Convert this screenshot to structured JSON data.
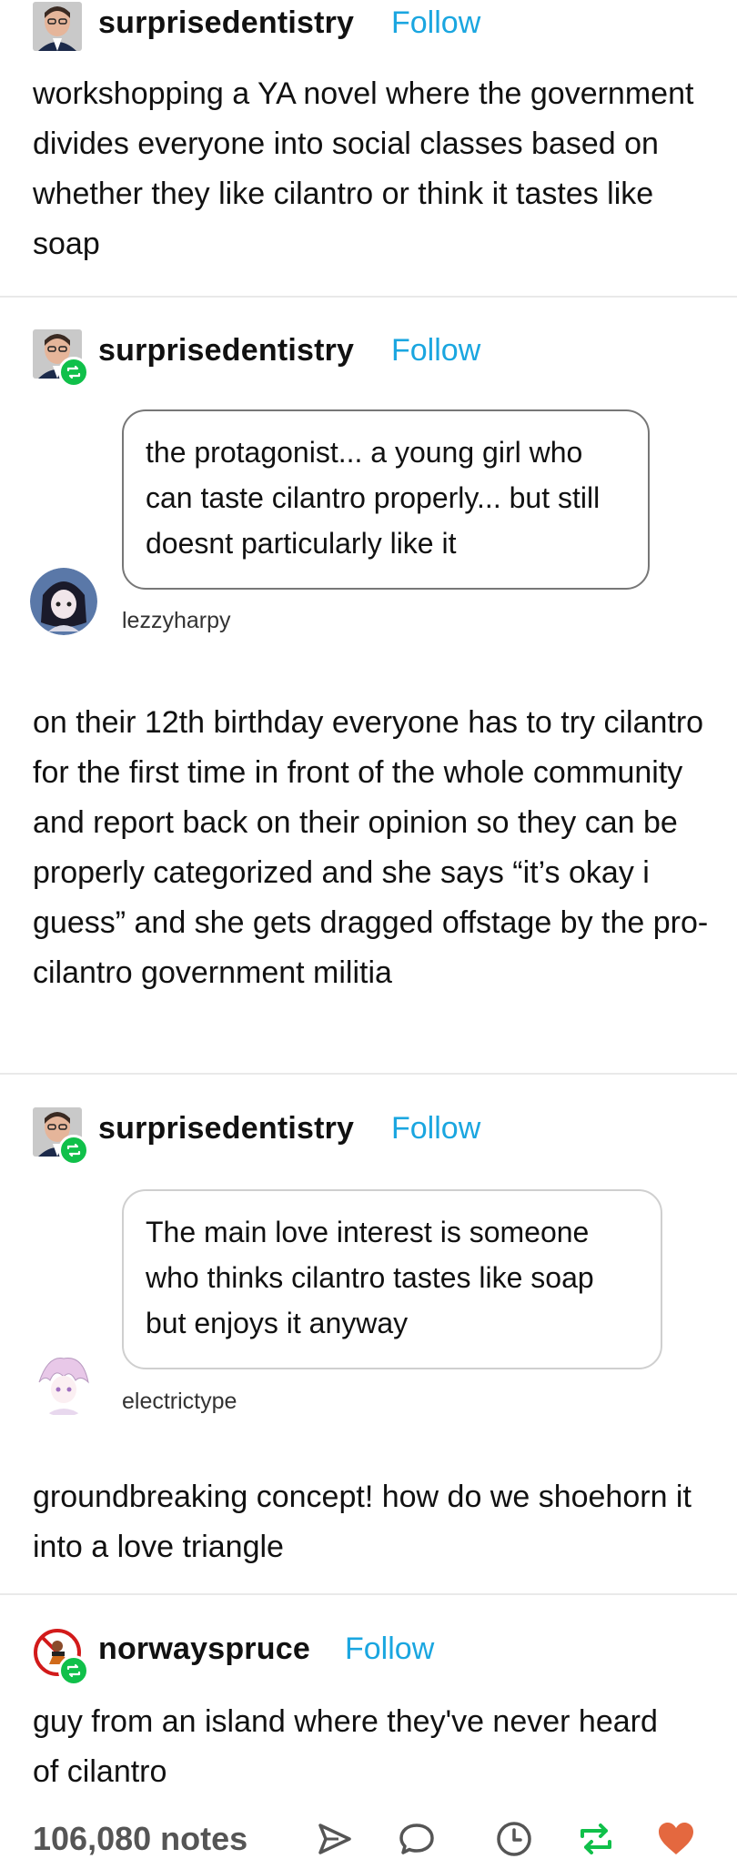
{
  "posts": [
    {
      "username": "surprisedentistry",
      "follow_label": "Follow",
      "body": "workshopping a YA novel where the government divides everyone into social classes based on whether they like cilantro or think it tastes like soap"
    },
    {
      "username": "surprisedentistry",
      "follow_label": "Follow",
      "ask_text": "the protagonist... a young girl who can taste cilantro properly... but still doesnt particularly like it",
      "asker": "lezzyharpy",
      "body": "on their 12th birthday everyone has to try cilantro for the first time in front of the whole community and report back on their opinion so they can be properly categorized and she says “it’s okay i guess” and she gets dragged offstage by the pro-cilantro government militia"
    },
    {
      "username": "surprisedentistry",
      "follow_label": "Follow",
      "ask_text": "The main love interest is someone who thinks cilantro tastes like soap but enjoys it anyway",
      "asker": "electrictype",
      "body": "groundbreaking concept! how do we shoehorn it into a love triangle"
    },
    {
      "username": "norwayspruce",
      "follow_label": "Follow",
      "body": "guy from an island where they've never heard of cilantro"
    }
  ],
  "footer": {
    "notes": "106,080 notes",
    "icons": [
      "share-icon",
      "reply-icon",
      "clock-icon",
      "reblog-icon",
      "like-icon"
    ]
  },
  "colors": {
    "follow": "#1aa6e0",
    "reblog": "#10c04a",
    "like": "#e4683f"
  }
}
